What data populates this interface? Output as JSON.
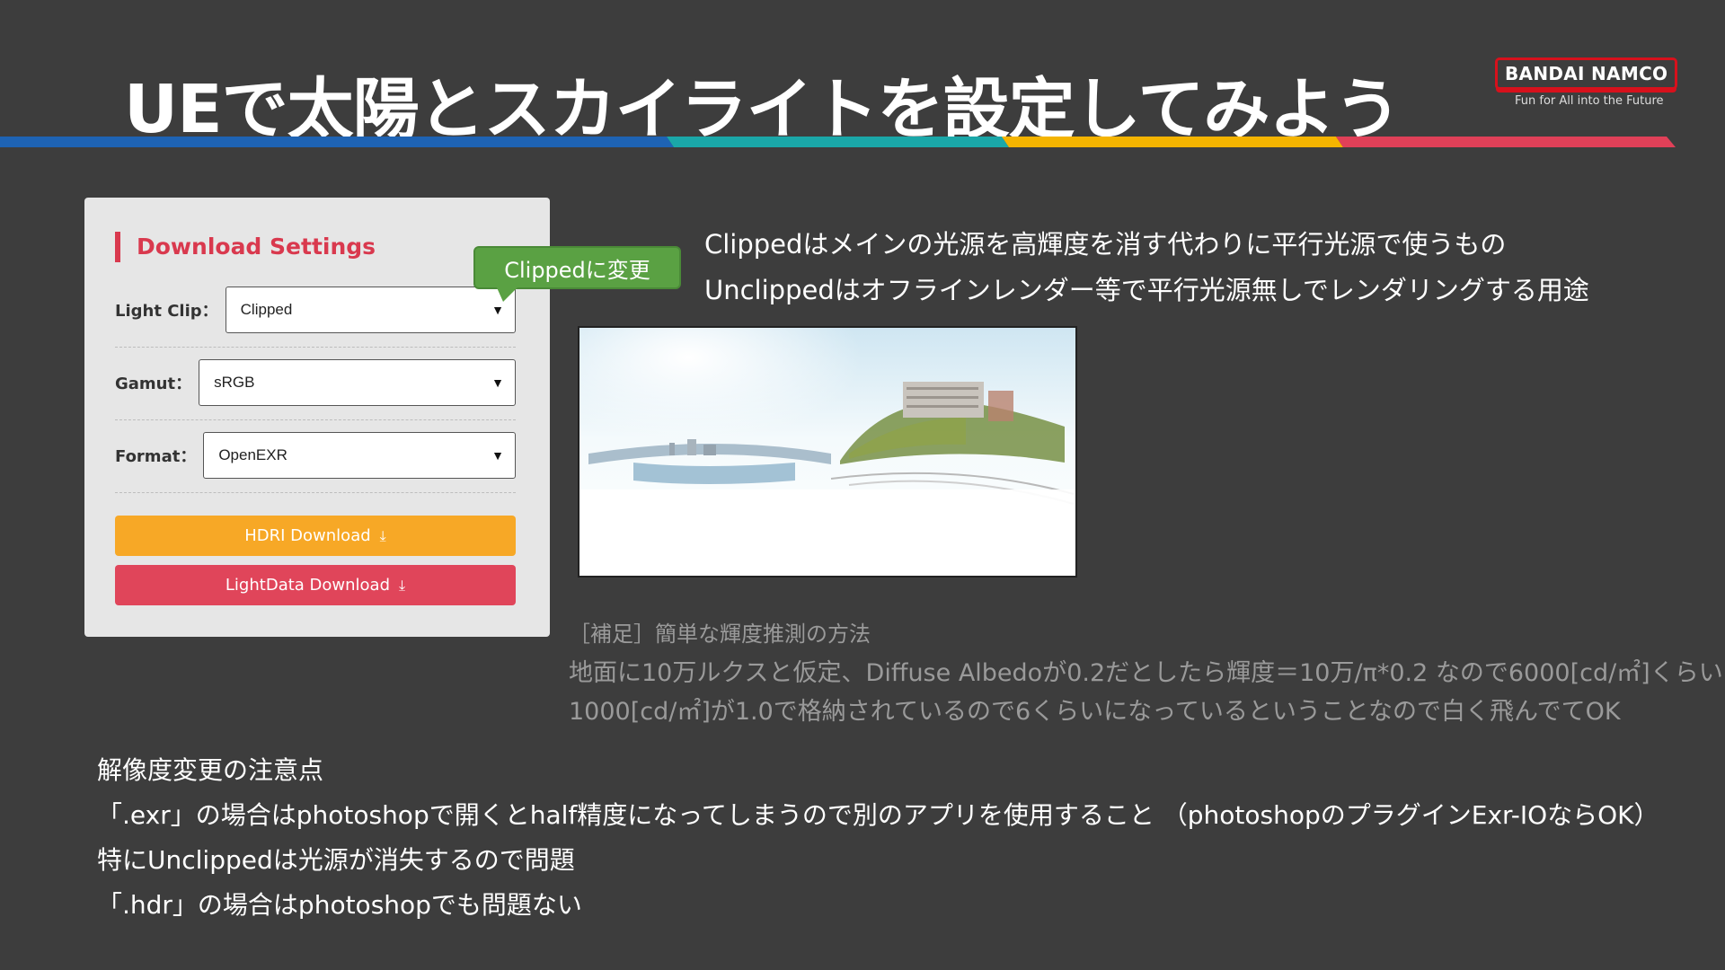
{
  "slide": {
    "title": "UEで太陽とスカイライトを設定してみよう"
  },
  "logo": {
    "brand": "BANDAI NAMCO",
    "tagline": "Fun for All into the Future"
  },
  "panel": {
    "title": "Download Settings",
    "light_clip_label": "Light Clip：",
    "light_clip_value": "Clipped",
    "gamut_label": "Gamut：",
    "gamut_value": "sRGB",
    "format_label": "Format：",
    "format_value": "OpenEXR",
    "hdri_button": "HDRI Download",
    "lightdata_button": "LightData Download"
  },
  "callout": {
    "text": "Clippedに変更"
  },
  "notes": {
    "line1": "Clippedはメインの光源を高輝度を消す代わりに平行光源で使うもの",
    "line2": "Unclippedはオフラインレンダー等で平行光源無しでレンダリングする用途"
  },
  "supplement": {
    "heading": "［補足］簡単な輝度推測の方法",
    "line1": "地面に10万ルクスと仮定、Diffuse Albedoが0.2だとしたら輝度＝10万/π*0.2 なので6000[cd/㎡]くらい",
    "line2": "1000[cd/㎡]が1.0で格納されているので6くらいになっているということなので白く飛んでてOK"
  },
  "resolution": {
    "heading": "解像度変更の注意点",
    "line1": "「.exr」の場合はphotoshopで開くとhalf精度になってしまうので別のアプリを使用すること （photoshopのプラグインExr-IOならOK）",
    "line2": "特にUnclippedは光源が消失するので問題",
    "line3": "「.hdr」の場合はphotoshopでも問題ない"
  },
  "icons": {
    "download": "download-icon",
    "dropdown": "chevron-down-icon"
  },
  "colors": {
    "background": "#3d3d3d",
    "accent_red": "#d9394e",
    "button_orange": "#f7a826",
    "button_red": "#e0455a",
    "callout_green": "#5aa143",
    "stripe_blue": "#1e63b4",
    "stripe_teal": "#1aa7a8",
    "stripe_yellow": "#f4b400",
    "stripe_pink": "#e04058"
  }
}
